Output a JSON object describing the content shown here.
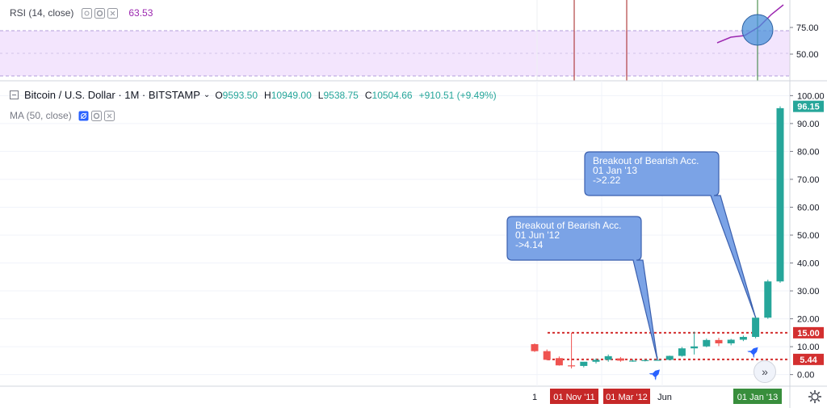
{
  "rsi": {
    "label": "RSI (14, close)",
    "value": "63.53",
    "axis_ticks": [
      "75.00",
      "50.00"
    ]
  },
  "main": {
    "symbol": "Bitcoin / U.S. Dollar · 1M · BITSTAMP",
    "ohlc": {
      "o_key": "O",
      "o_val": "9593.50",
      "h_key": "H",
      "h_val": "10949.00",
      "l_key": "L",
      "l_val": "9538.75",
      "c_key": "C",
      "c_val": "10504.66",
      "change": "+910.51 (+9.49%)"
    },
    "ma_label": "MA (50, close)"
  },
  "chart_data": {
    "type": "candlestick",
    "y_ticks": [
      0,
      10,
      20,
      30,
      40,
      50,
      60,
      70,
      80,
      90,
      100
    ],
    "y_tick_labels": [
      "0.00",
      "10.00",
      "20.00",
      "30.00",
      "40.00",
      "50.00",
      "60.00",
      "70.00",
      "80.00",
      "90.00",
      "100.00"
    ],
    "ylim": [
      -3,
      103
    ],
    "x_labels": [
      {
        "text": "1",
        "highlight": false
      },
      {
        "text": "01 Nov '11",
        "highlight": "red"
      },
      {
        "text": "01 Mar '12",
        "highlight": "red"
      },
      {
        "text": "Jun",
        "highlight": false
      },
      {
        "text": "01 Jan '13",
        "highlight": "green"
      }
    ],
    "candles": [
      {
        "o": 10.9,
        "h": 11.2,
        "l": 8.1,
        "c": 8.4
      },
      {
        "o": 8.4,
        "h": 9.0,
        "l": 5.1,
        "c": 5.3
      },
      {
        "o": 5.9,
        "h": 6.5,
        "l": 3.2,
        "c": 3.3
      },
      {
        "o": 3.3,
        "h": 15.0,
        "l": 2.2,
        "c": 3.1
      },
      {
        "o": 3.1,
        "h": 4.5,
        "l": 2.6,
        "c": 4.6
      },
      {
        "o": 4.6,
        "h": 5.8,
        "l": 4.0,
        "c": 5.3
      },
      {
        "o": 5.3,
        "h": 7.2,
        "l": 4.6,
        "c": 6.6
      },
      {
        "o": 5.8,
        "h": 6.3,
        "l": 4.6,
        "c": 5.0
      },
      {
        "o": 5.0,
        "h": 5.5,
        "l": 4.6,
        "c": 5.0
      },
      {
        "o": 5.0,
        "h": 5.4,
        "l": 4.7,
        "c": 5.2
      },
      {
        "o": 5.2,
        "h": 6.5,
        "l": 5.0,
        "c": 5.3
      },
      {
        "o": 5.3,
        "h": 6.8,
        "l": 5.1,
        "c": 6.7
      },
      {
        "o": 6.7,
        "h": 9.9,
        "l": 6.4,
        "c": 9.4
      },
      {
        "o": 9.4,
        "h": 15.4,
        "l": 7.2,
        "c": 10.1
      },
      {
        "o": 10.1,
        "h": 12.9,
        "l": 9.8,
        "c": 12.4
      },
      {
        "o": 12.4,
        "h": 13.2,
        "l": 10.2,
        "c": 11.2
      },
      {
        "o": 11.2,
        "h": 12.8,
        "l": 10.5,
        "c": 12.5
      },
      {
        "o": 12.5,
        "h": 14.0,
        "l": 12.0,
        "c": 13.5
      },
      {
        "o": 13.5,
        "h": 21.0,
        "l": 13.0,
        "c": 20.4
      },
      {
        "o": 20.4,
        "h": 34.0,
        "l": 20.0,
        "c": 33.4
      },
      {
        "o": 33.4,
        "h": 96.15,
        "l": 32.9,
        "c": 95.5
      }
    ],
    "current_price": "96.15",
    "horizontal_lines": [
      {
        "value": 15.0,
        "label": "15.00",
        "color": "#d32f2f"
      },
      {
        "value": 5.44,
        "label": "5.44",
        "color": "#d32f2f"
      }
    ],
    "annotations": [
      {
        "lines": [
          "Breakout of Bearish Acc.",
          "01 Jun '12",
          "->4.14"
        ],
        "anchor_index": 10,
        "anchor_value": 5.3
      },
      {
        "lines": [
          "Breakout of Bearish Acc.",
          "01 Jan '13",
          "->2.22"
        ],
        "anchor_index": 18,
        "anchor_value": 20.4
      }
    ],
    "markers": [
      {
        "index": 10,
        "icon": "rocket-icon"
      },
      {
        "index": 18,
        "icon": "rocket-icon"
      }
    ],
    "colors": {
      "up": "#26a69a",
      "down": "#ef5350",
      "annotation_fill": "#7ba3e6",
      "annotation_stroke": "#3a5fae",
      "rsi_band": "#f3e5fd",
      "rsi_line": "#9c27b0"
    }
  }
}
